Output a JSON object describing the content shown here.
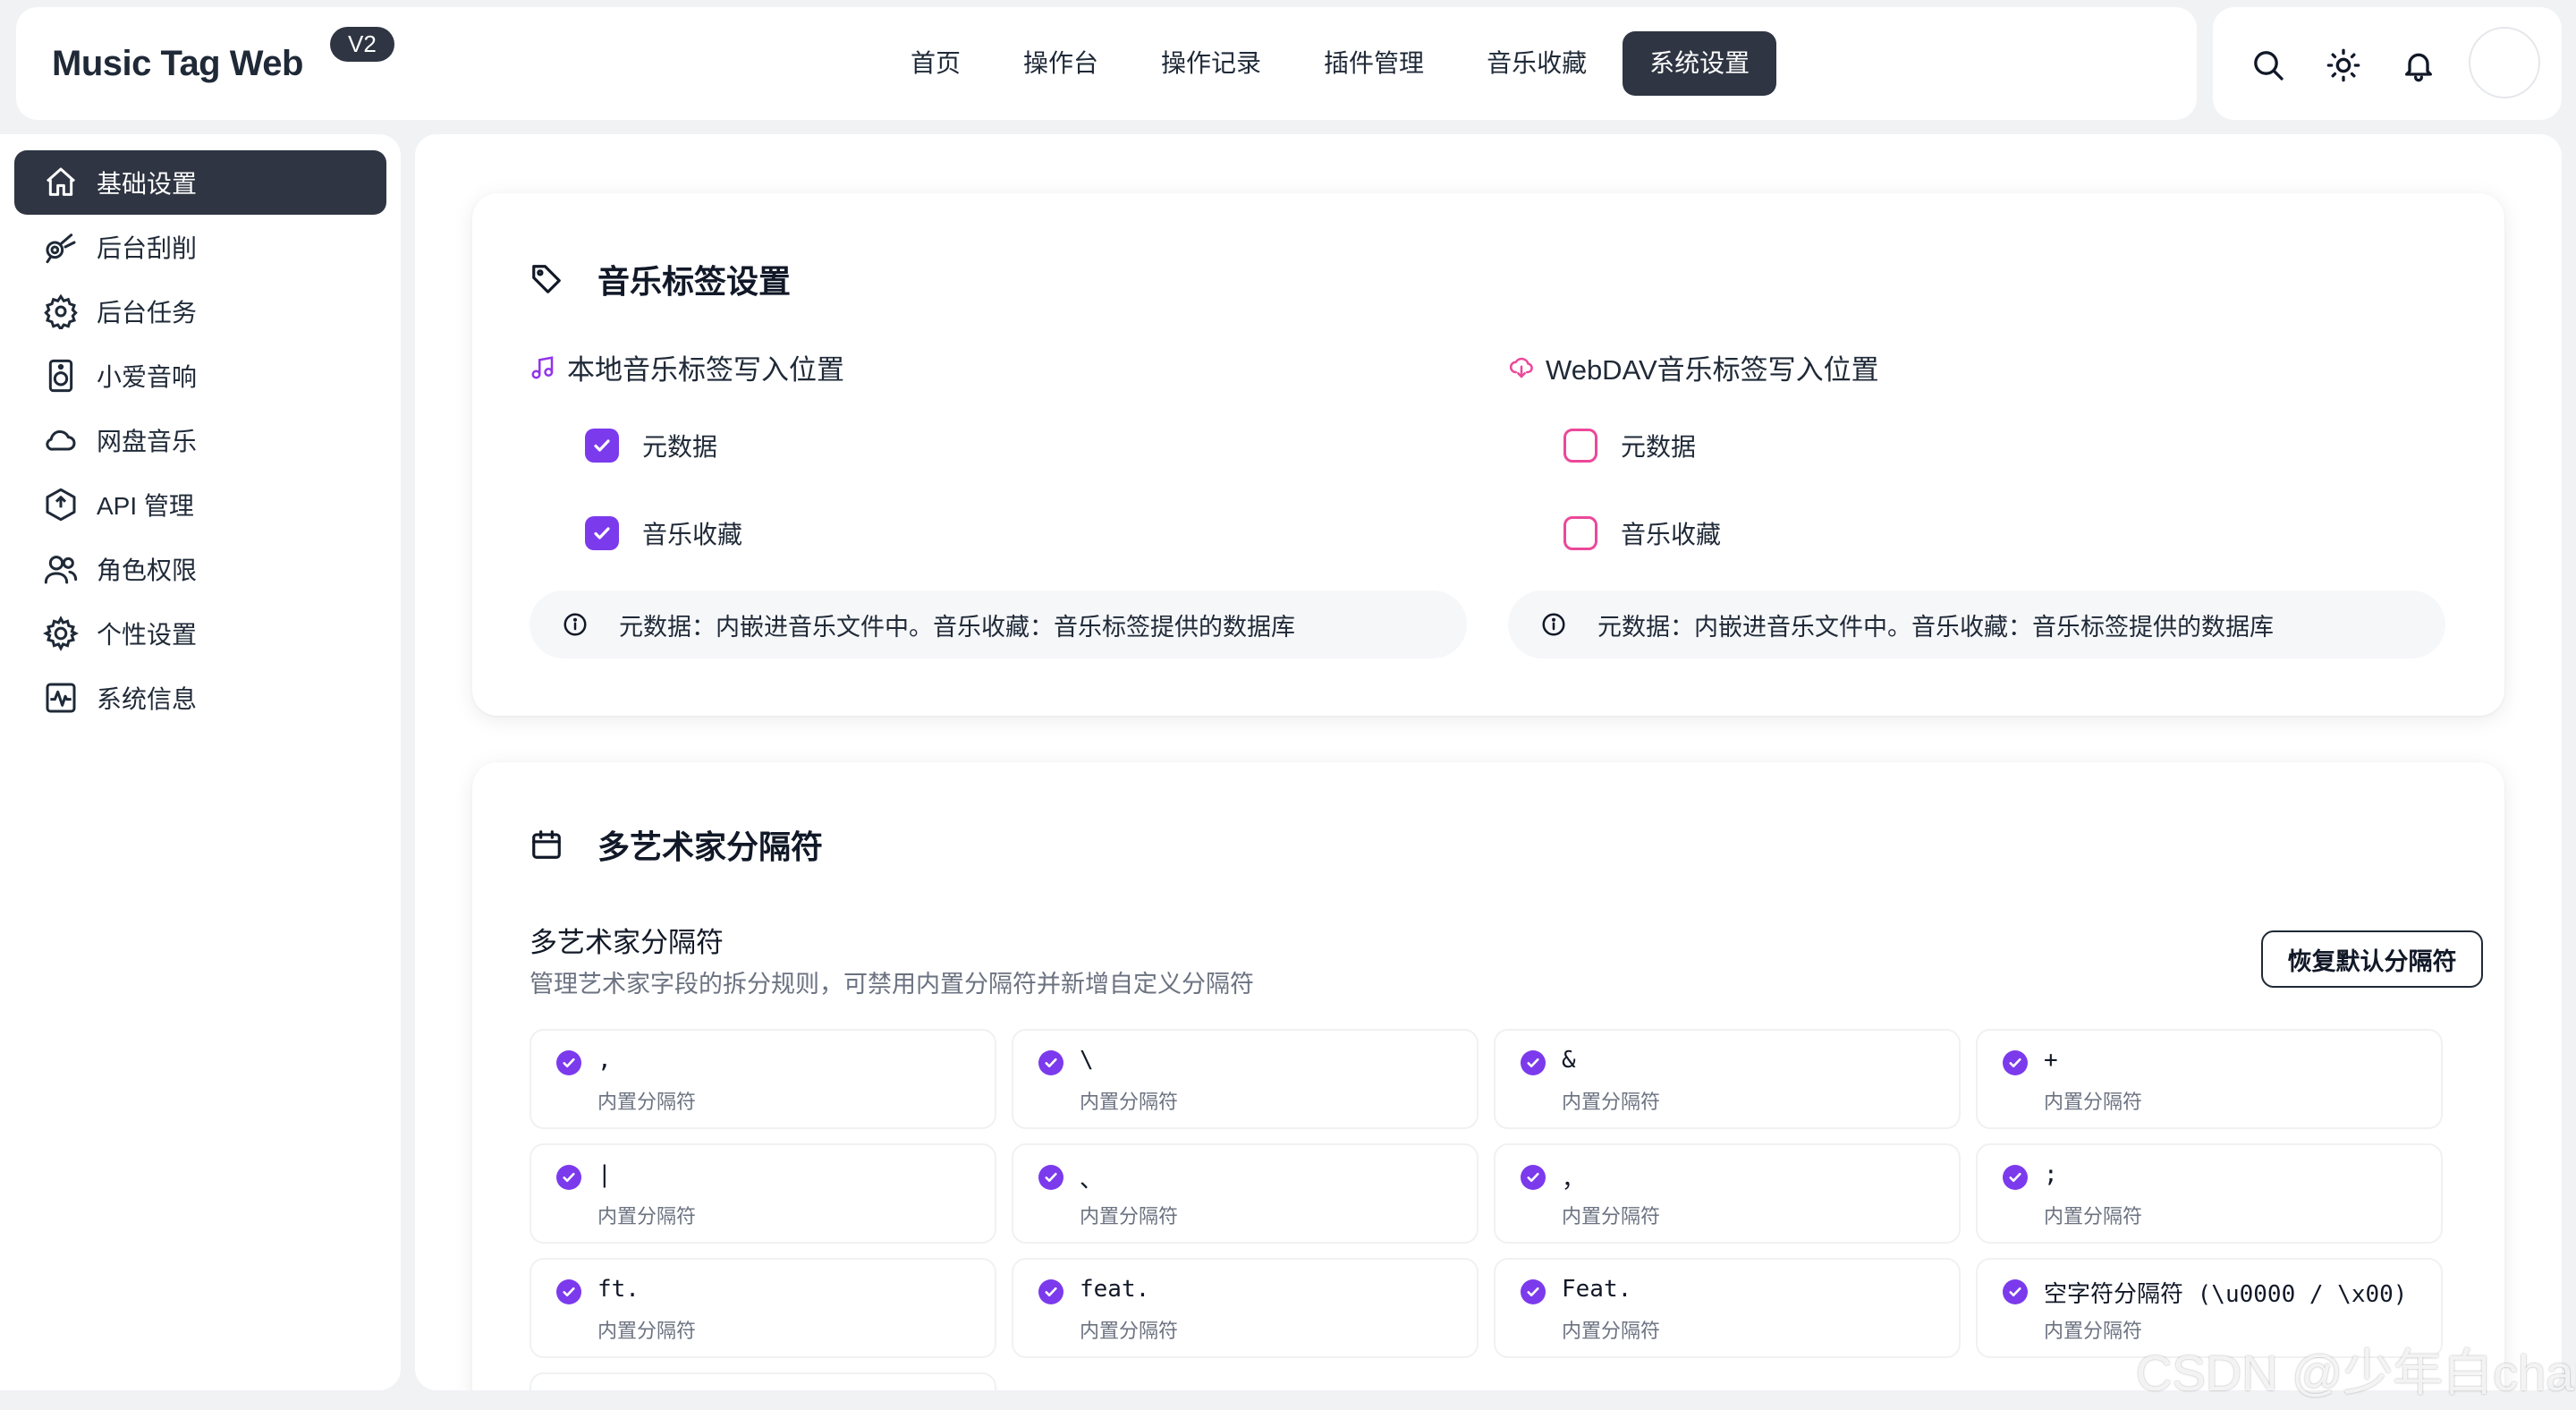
{
  "app": {
    "title": "Music Tag Web",
    "version": "V2"
  },
  "nav": {
    "items": [
      {
        "label": "首页",
        "active": false
      },
      {
        "label": "操作台",
        "active": false
      },
      {
        "label": "操作记录",
        "active": false
      },
      {
        "label": "插件管理",
        "active": false
      },
      {
        "label": "音乐收藏",
        "active": false
      },
      {
        "label": "系统设置",
        "active": true
      }
    ]
  },
  "toolbar": {
    "icons": [
      "search-icon",
      "sun-icon",
      "bell-icon",
      "avatar"
    ]
  },
  "sidebar": {
    "items": [
      {
        "label": "基础设置",
        "icon": "home-icon",
        "active": true
      },
      {
        "label": "后台刮削",
        "icon": "telescope-icon",
        "active": false
      },
      {
        "label": "后台任务",
        "icon": "gear-icon",
        "active": false
      },
      {
        "label": "小爱音响",
        "icon": "speaker-icon",
        "active": false
      },
      {
        "label": "网盘音乐",
        "icon": "cloud-icon",
        "active": false
      },
      {
        "label": "API 管理",
        "icon": "api-icon",
        "active": false
      },
      {
        "label": "角色权限",
        "icon": "users-icon",
        "active": false
      },
      {
        "label": "个性设置",
        "icon": "cog-icon",
        "active": false
      },
      {
        "label": "系统信息",
        "icon": "activity-icon",
        "active": false
      }
    ]
  },
  "music_tag": {
    "title": "音乐标签设置",
    "local": {
      "heading": "本地音乐标签写入位置",
      "options": [
        {
          "label": "元数据",
          "checked": true
        },
        {
          "label": "音乐收藏",
          "checked": true
        }
      ],
      "info": "元数据：内嵌进音乐文件中。音乐收藏：音乐标签提供的数据库"
    },
    "webdav": {
      "heading": "WebDAV音乐标签写入位置",
      "options": [
        {
          "label": "元数据",
          "checked": false
        },
        {
          "label": "音乐收藏",
          "checked": false
        }
      ],
      "info": "元数据：内嵌进音乐文件中。音乐收藏：音乐标签提供的数据库"
    }
  },
  "separators": {
    "title": "多艺术家分隔符",
    "subtitle": "多艺术家分隔符",
    "description": "管理艺术家字段的拆分规则，可禁用内置分隔符并新增自定义分隔符",
    "reset_label": "恢复默认分隔符",
    "items": [
      {
        "value": ",",
        "sub": "内置分隔符"
      },
      {
        "value": "\\",
        "sub": "内置分隔符"
      },
      {
        "value": "&",
        "sub": "内置分隔符"
      },
      {
        "value": "+",
        "sub": "内置分隔符"
      },
      {
        "value": "|",
        "sub": "内置分隔符"
      },
      {
        "value": "、",
        "sub": "内置分隔符"
      },
      {
        "value": "，",
        "sub": "内置分隔符"
      },
      {
        "value": ";",
        "sub": "内置分隔符"
      },
      {
        "value": "ft.",
        "sub": "内置分隔符"
      },
      {
        "value": "feat.",
        "sub": "内置分隔符"
      },
      {
        "value": "Feat.",
        "sub": "内置分隔符"
      },
      {
        "value": "空字符分隔符 (\\u0000 / \\x00)",
        "sub": "内置分隔符"
      }
    ]
  },
  "watermark": "CSDN @少年白char",
  "colors": {
    "accent_dark": "#2f3542",
    "check_purple": "#7c3aed",
    "check_pink": "#ec4899"
  }
}
